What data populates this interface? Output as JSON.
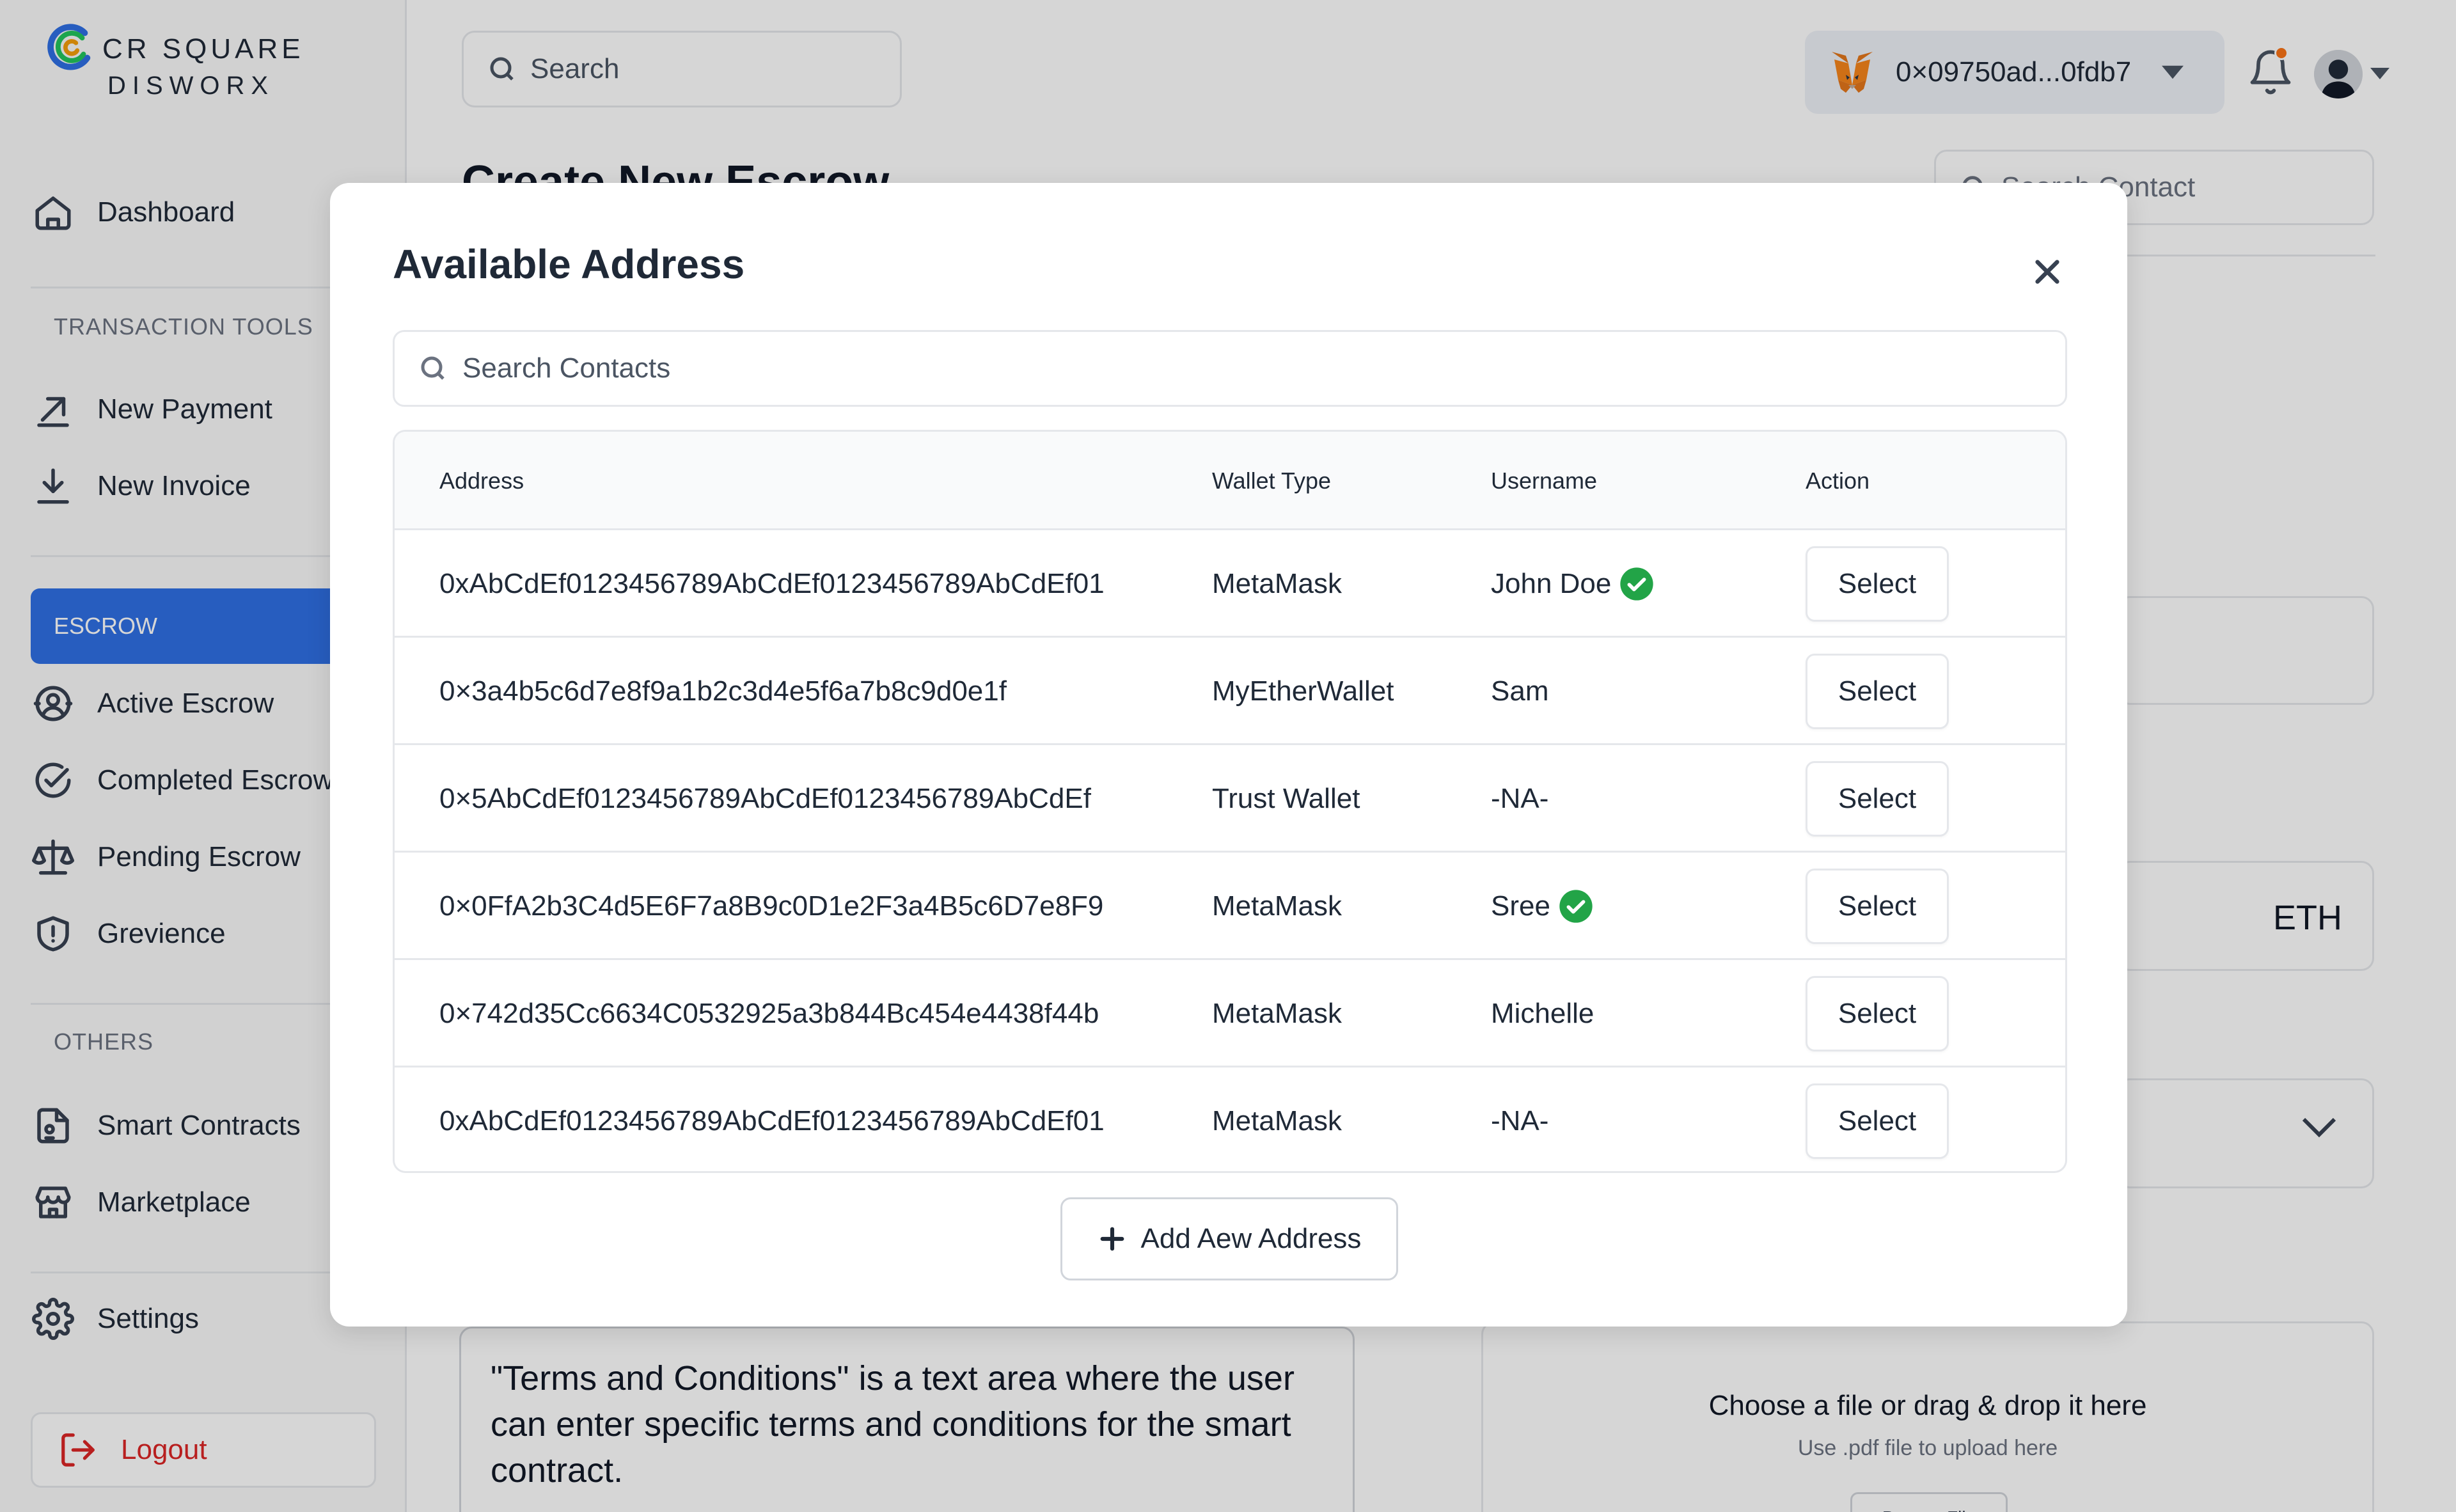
{
  "brand": {
    "line1": "CR SQUARE",
    "line2": "DISWORX"
  },
  "sidebar": {
    "dashboard": "Dashboard",
    "transaction_tools_label": "TRANSACTION TOOLS",
    "new_payment": "New Payment",
    "new_invoice": "New Invoice",
    "escrow_label": "ESCROW",
    "active_escrow": "Active Escrow",
    "completed_escrow": "Completed Escrow",
    "pending_escrow": "Pending Escrow",
    "grievance": "Grevience",
    "others_label": "OTHERS",
    "smart_contracts": "Smart Contracts",
    "marketplace": "Marketplace",
    "settings": "Settings",
    "logout": "Logout"
  },
  "topbar": {
    "search_placeholder": "Search",
    "wallet_address": "0×09750ad...0fdb7"
  },
  "page": {
    "title": "Create New Escrow",
    "contact_search_placeholder": "Search Contact",
    "currency": "ETH",
    "terms_text": "\"Terms and Conditions\" is a text area where the user can enter specific terms and conditions for the smart contract.",
    "upload_title": "Choose a file or drag & drop it here",
    "upload_subtitle": "Use .pdf file to upload here",
    "upload_button": "Browse File"
  },
  "modal": {
    "title": "Available Address",
    "search_placeholder": "Search Contacts",
    "columns": {
      "address": "Address",
      "wallet_type": "Wallet Type",
      "username": "Username",
      "action": "Action"
    },
    "rows": [
      {
        "address": "0xAbCdEf0123456789AbCdEf0123456789AbCdEf01",
        "wallet_type": "MetaMask",
        "username": "John Doe",
        "verified": true,
        "action": "Select"
      },
      {
        "address": "0×3a4b5c6d7e8f9a1b2c3d4e5f6a7b8c9d0e1f",
        "wallet_type": "MyEtherWallet",
        "username": "Sam",
        "verified": false,
        "action": "Select"
      },
      {
        "address": "0×5AbCdEf0123456789AbCdEf0123456789AbCdEf",
        "wallet_type": "Trust Wallet",
        "username": "-NA-",
        "verified": false,
        "action": "Select"
      },
      {
        "address": "0×0FfA2b3C4d5E6F7a8B9c0D1e2F3a4B5c6D7e8F9",
        "wallet_type": "MetaMask",
        "username": "Sree",
        "verified": true,
        "action": "Select"
      },
      {
        "address": "0×742d35Cc6634C0532925a3b844Bc454e4438f44b",
        "wallet_type": "MetaMask",
        "username": "Michelle",
        "verified": false,
        "action": "Select"
      },
      {
        "address": "0xAbCdEf0123456789AbCdEf0123456789AbCdEf01",
        "wallet_type": "MetaMask",
        "username": "-NA-",
        "verified": false,
        "action": "Select"
      }
    ],
    "add_button": "Add Aew Address"
  },
  "colors": {
    "accent": "#2f6fe4",
    "verified": "#22a447",
    "danger": "#dc2626",
    "notification": "#f97316"
  },
  "icons": {
    "sidebar": [
      "home-icon",
      "arrow-up-right-icon",
      "download-icon",
      "active-escrow-icon",
      "check-circle-icon",
      "scale-icon",
      "shield-alert-icon",
      "contract-icon",
      "store-icon",
      "gear-icon",
      "logout-icon"
    ],
    "topbar": [
      "search-icon",
      "metamask-fox-icon",
      "chevron-down-icon",
      "bell-icon",
      "avatar"
    ],
    "modal": [
      "close-icon",
      "search-icon",
      "verified-check-icon",
      "plus-icon"
    ]
  }
}
